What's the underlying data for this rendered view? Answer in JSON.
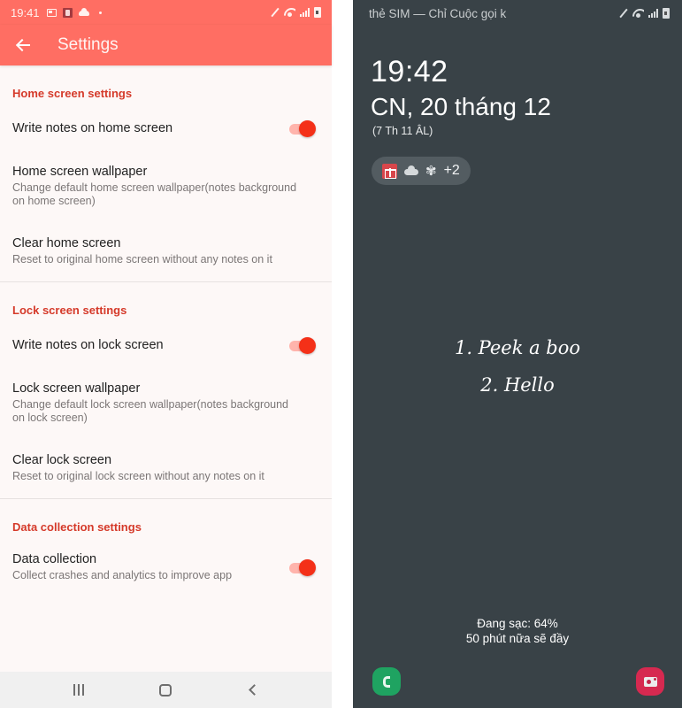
{
  "left": {
    "status_bar": {
      "time": "19:41",
      "icons": [
        "gallery-icon",
        "calendar-icon",
        "cloud-icon",
        "dot-icon",
        "no-sim-icon",
        "wifi-icon",
        "signal-icon",
        "battery-icon"
      ]
    },
    "app_bar": {
      "back_icon": "arrow-left-icon",
      "title": "Settings"
    },
    "sections": [
      {
        "header": "Home screen settings",
        "items": [
          {
            "title": "Write notes on home screen",
            "summary": null,
            "toggle": true
          },
          {
            "title": "Home screen wallpaper",
            "summary": "Change default home screen wallpaper(notes background on home screen)"
          },
          {
            "title": "Clear home screen",
            "summary": "Reset to original home screen without any notes on it"
          }
        ]
      },
      {
        "header": "Lock screen settings",
        "items": [
          {
            "title": "Write notes on lock screen",
            "summary": null,
            "toggle": true
          },
          {
            "title": "Lock screen wallpaper",
            "summary": "Change default lock screen wallpaper(notes background on lock screen)"
          },
          {
            "title": "Clear lock screen",
            "summary": "Reset to original lock screen without any notes on it"
          }
        ]
      },
      {
        "header": "Data collection settings",
        "items": [
          {
            "title": "Data collection",
            "summary": "Collect crashes and analytics to improve app",
            "toggle": true
          }
        ]
      }
    ],
    "nav_bar": {
      "recents_icon": "recents-icon",
      "home_icon": "home-icon",
      "back_icon": "back-icon"
    },
    "colors": {
      "accent": "#ff6e63",
      "section_header": "#d53a2a",
      "toggle_on": "#f43018"
    }
  },
  "right": {
    "status_bar": {
      "carrier_text": "thẻ SIM — Chỉ Cuộc gọi k",
      "icons": [
        "no-sim-icon",
        "wifi-icon",
        "signal-icon",
        "battery-icon"
      ]
    },
    "clock": "19:42",
    "date": "CN, 20 tháng 12",
    "lunar_date": "(7 Th 11 ÂL)",
    "notifications": {
      "icons": [
        "gift-icon",
        "cloud-icon",
        "flower-icon"
      ],
      "more": "+2"
    },
    "notes": [
      "1. Peek a boo",
      "2. Hello"
    ],
    "charging": {
      "line1": "Đang sạc: 64%",
      "line2": "50 phút nữa sẽ đầy"
    },
    "shortcuts": {
      "left": "phone-shortcut",
      "right": "camera-shortcut"
    },
    "colors": {
      "background": "#394247",
      "phone": "#1fa361",
      "camera": "#d62950"
    }
  }
}
